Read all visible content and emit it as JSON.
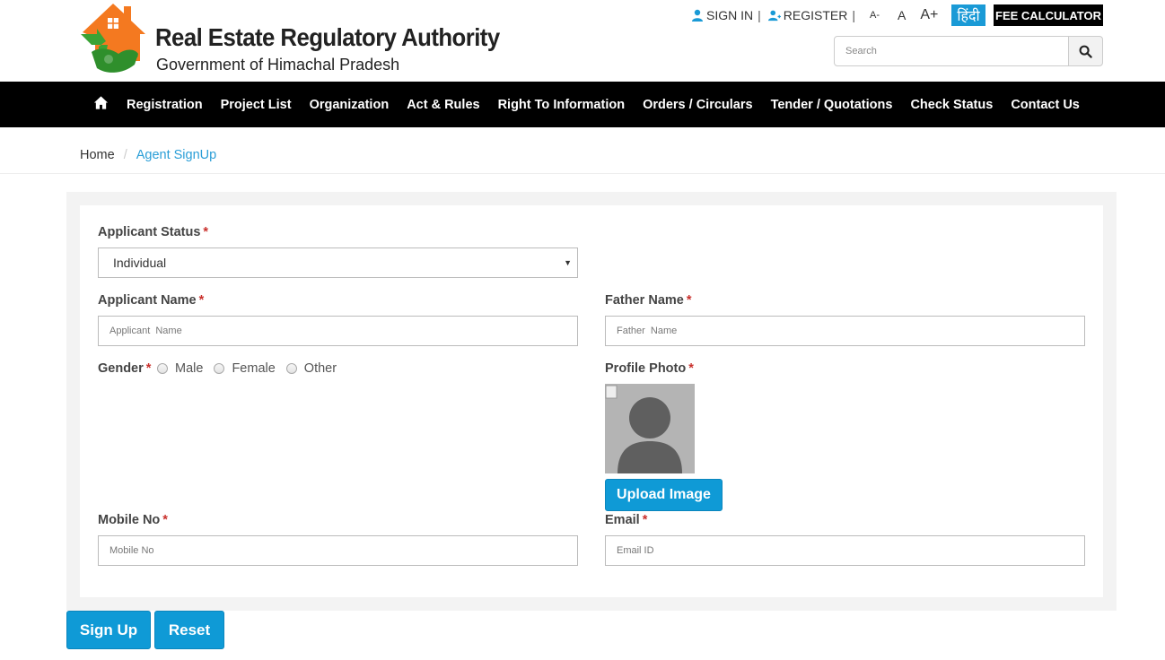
{
  "header": {
    "title": "Real Estate Regulatory Authority",
    "subtitle": "Government of Himachal Pradesh",
    "links": {
      "sign_in": "SIGN IN",
      "register": "REGISTER",
      "sep": "|"
    },
    "font_sizes": {
      "small": "A-",
      "normal": "A",
      "large": "A+"
    },
    "hindi": "हिंदी",
    "fee_calculator": "FEE CALCULATOR",
    "search": {
      "placeholder": "Search"
    },
    "colors": {
      "accent": "#1a9ad6",
      "logo_orange": "#f47920",
      "logo_green": "#3aa335"
    }
  },
  "nav": {
    "home_icon": "home-icon",
    "items": [
      "Registration",
      "Project List",
      "Organization",
      "Act & Rules",
      "Right To Information",
      "Orders / Circulars",
      "Tender / Quotations",
      "Check Status",
      "Contact Us"
    ]
  },
  "breadcrumb": {
    "home": "Home",
    "separator": "/",
    "current": "Agent SignUp"
  },
  "form": {
    "applicant_status": {
      "label": "Applicant Status",
      "required": "*",
      "value": "Individual"
    },
    "applicant_name": {
      "label": "Applicant Name",
      "required": "*",
      "placeholder": "Applicant  Name"
    },
    "father_name": {
      "label": "Father Name",
      "required": "*",
      "placeholder": "Father  Name"
    },
    "gender": {
      "label": "Gender",
      "required": "*",
      "options": [
        "Male",
        "Female",
        "Other"
      ]
    },
    "profile_photo": {
      "label": "Profile Photo",
      "required": "*",
      "upload_label": "Upload Image"
    },
    "mobile": {
      "label": "Mobile No",
      "required": "*",
      "placeholder": "Mobile No"
    },
    "email": {
      "label": "Email",
      "required": "*",
      "placeholder": "Email ID"
    }
  },
  "actions": {
    "sign_up": "Sign Up",
    "reset": "Reset"
  }
}
